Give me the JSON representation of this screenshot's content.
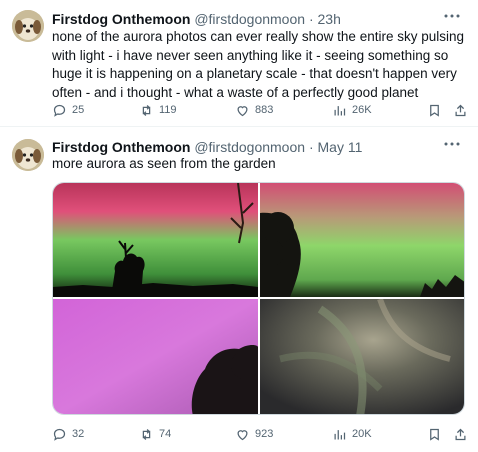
{
  "tweets": [
    {
      "author": {
        "name": "Firstdog Onthemoon",
        "handle": "@firstdogonmoon"
      },
      "separator": "·",
      "time": "23h",
      "text": "none of the aurora photos can ever really show the entire sky pulsing with light - i have never seen anything like it - seeing something so huge it is happening on a planetary scale - that doesn't happen very often - and i thought - what a waste of a perfectly good planet",
      "stats": {
        "replies": "25",
        "reposts": "119",
        "likes": "883",
        "views": "26K"
      }
    },
    {
      "author": {
        "name": "Firstdog Onthemoon",
        "handle": "@firstdogonmoon"
      },
      "separator": "·",
      "time": "May 11",
      "text": "more aurora as seen from the garden",
      "stats": {
        "replies": "32",
        "reposts": "74",
        "likes": "923",
        "views": "20K"
      },
      "media_count": 4
    }
  ],
  "icons": {
    "more": "more-dots-icon",
    "reply": "reply-icon",
    "repost": "repost-icon",
    "like": "heart-icon",
    "views": "views-icon",
    "bookmark": "bookmark-icon",
    "share": "share-icon"
  },
  "colors": {
    "text": "#0f1419",
    "secondary": "#536471",
    "divider": "#eff3f4",
    "aurora_pink": "#e0507a",
    "aurora_green": "#6fc45a",
    "aurora_magenta": "#d878dc"
  }
}
